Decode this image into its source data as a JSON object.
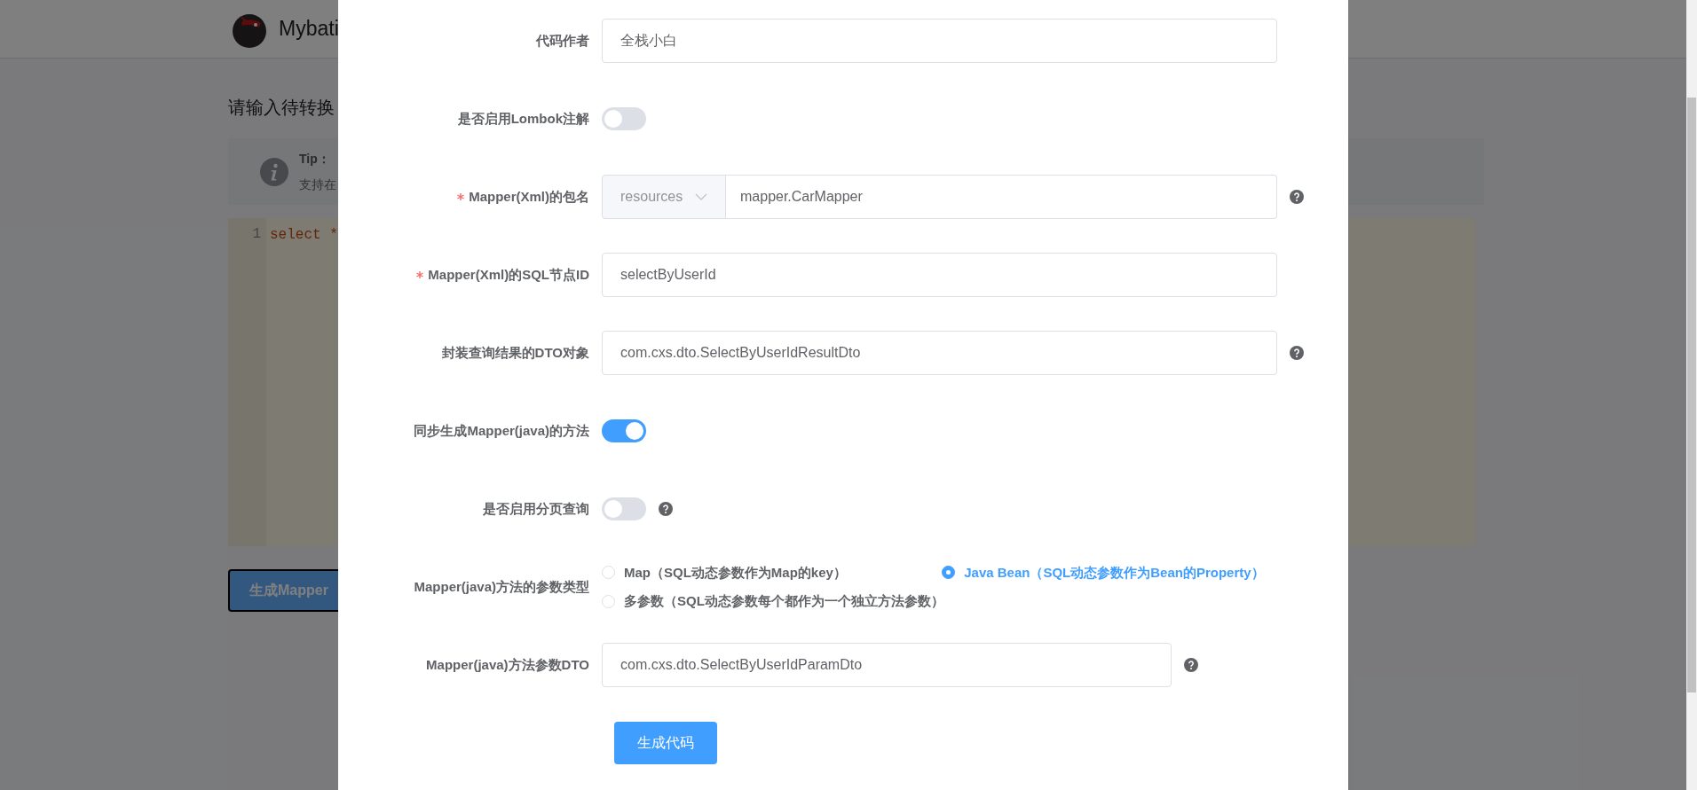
{
  "background": {
    "app_title": "Mybati",
    "heading": "请输入待转换",
    "tip": {
      "title": "Tip：",
      "text": "支持在"
    },
    "editor": {
      "line_number": "1",
      "code": "select *"
    },
    "button": "生成Mapper"
  },
  "dialog": {
    "fields": [
      {
        "kind": "text",
        "label": "代码作者",
        "required": false,
        "value": "全栈小白",
        "help": false
      },
      {
        "kind": "switch",
        "label": "是否启用Lombok注解",
        "required": false,
        "on": false,
        "help": false
      },
      {
        "kind": "prefixed",
        "label": "Mapper(Xml)的包名",
        "required": true,
        "prefix": "resources",
        "value": "mapper.CarMapper",
        "help": true
      },
      {
        "kind": "text",
        "label": "Mapper(Xml)的SQL节点ID",
        "required": true,
        "value": "selectByUserId",
        "help": false
      },
      {
        "kind": "text",
        "label": "封装查询结果的DTO对象",
        "required": false,
        "value": "com.cxs.dto.SelectByUserIdResultDto",
        "help": true
      },
      {
        "kind": "switch",
        "label": "同步生成Mapper(java)的方法",
        "required": false,
        "on": true,
        "help": false
      },
      {
        "kind": "switch",
        "label": "是否启用分页查询",
        "required": false,
        "on": false,
        "help": true
      },
      {
        "kind": "radio",
        "label": "Mapper(java)方法的参数类型",
        "required": false,
        "help": false,
        "options": [
          {
            "label": "Map（SQL动态参数作为Map的key）",
            "selected": false
          },
          {
            "label": "Java Bean（SQL动态参数作为Bean的Property）",
            "selected": true
          },
          {
            "label": "多参数（SQL动态参数每个都作为一个独立方法参数）",
            "selected": false
          }
        ]
      },
      {
        "kind": "short_text",
        "label": "Mapper(java)方法参数DTO",
        "required": false,
        "value": "com.cxs.dto.SelectByUserIdParamDto",
        "help": true
      }
    ],
    "submit": "生成代码"
  }
}
